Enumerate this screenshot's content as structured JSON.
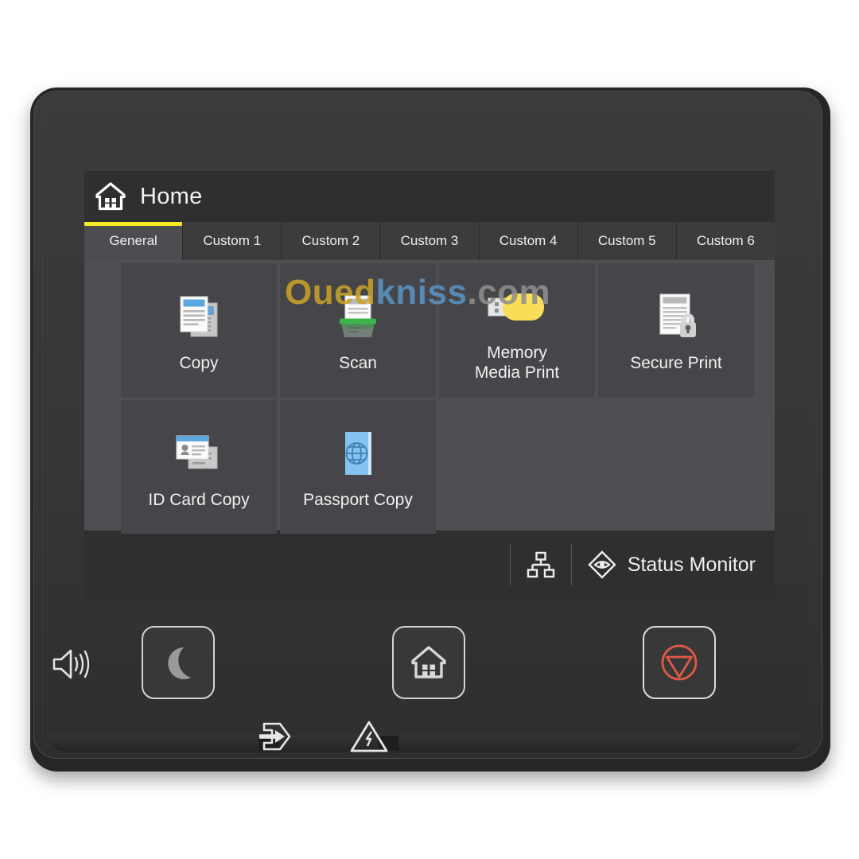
{
  "device": {
    "type": "printer-control-panel",
    "bezel_color": "#363636",
    "screen_bg": "#3a3a3a"
  },
  "screen": {
    "header": {
      "title": "Home",
      "home_icon": "home-icon"
    },
    "accent_color": "#f5ea21",
    "tabs": [
      {
        "label": "General",
        "active": true
      },
      {
        "label": "Custom 1",
        "active": false
      },
      {
        "label": "Custom 2",
        "active": false
      },
      {
        "label": "Custom 3",
        "active": false
      },
      {
        "label": "Custom 4",
        "active": false
      },
      {
        "label": "Custom 5",
        "active": false
      },
      {
        "label": "Custom 6",
        "active": false
      }
    ],
    "apps": [
      {
        "label": "Copy",
        "icon": "copy-documents-icon",
        "accent": "#5aa7e0"
      },
      {
        "label": "Scan",
        "icon": "scanner-icon",
        "accent": "#3cb44b"
      },
      {
        "label": "Memory\nMedia Print",
        "icon": "usb-flash-drive-icon",
        "accent": "#f7dd58"
      },
      {
        "label": "Secure Print",
        "icon": "document-lock-icon",
        "accent": "#c9c9c9"
      },
      {
        "label": "ID Card Copy",
        "icon": "id-card-icon",
        "accent": "#5aa7e0"
      },
      {
        "label": "Passport Copy",
        "icon": "passport-globe-icon",
        "accent": "#86c2ef"
      }
    ],
    "status_bar": {
      "network_icon": "network-lan-icon",
      "monitor_icon": "status-monitor-eye-icon",
      "monitor_label": "Status Monitor"
    }
  },
  "watermark": {
    "part1": "Oued",
    "part2": "kniss",
    "part3": ".com",
    "color1": "#c9a227",
    "color2": "#5b93c4",
    "color3": "#8e8e8e"
  },
  "hardware": {
    "speaker_icon": "speaker-volume-icon",
    "keys": [
      {
        "name": "energy-saver-button",
        "icon": "crescent-moon-icon",
        "color": "#9a9a9a"
      },
      {
        "name": "home-button",
        "icon": "home-icon",
        "color": "#d8d8d8"
      },
      {
        "name": "stop-button",
        "icon": "stop-triangle-icon",
        "color": "#e05a45"
      }
    ],
    "indicators": [
      {
        "name": "data-in-indicator",
        "icon": "data-arrow-icon"
      },
      {
        "name": "error-indicator",
        "icon": "warning-triangle-icon"
      }
    ]
  }
}
